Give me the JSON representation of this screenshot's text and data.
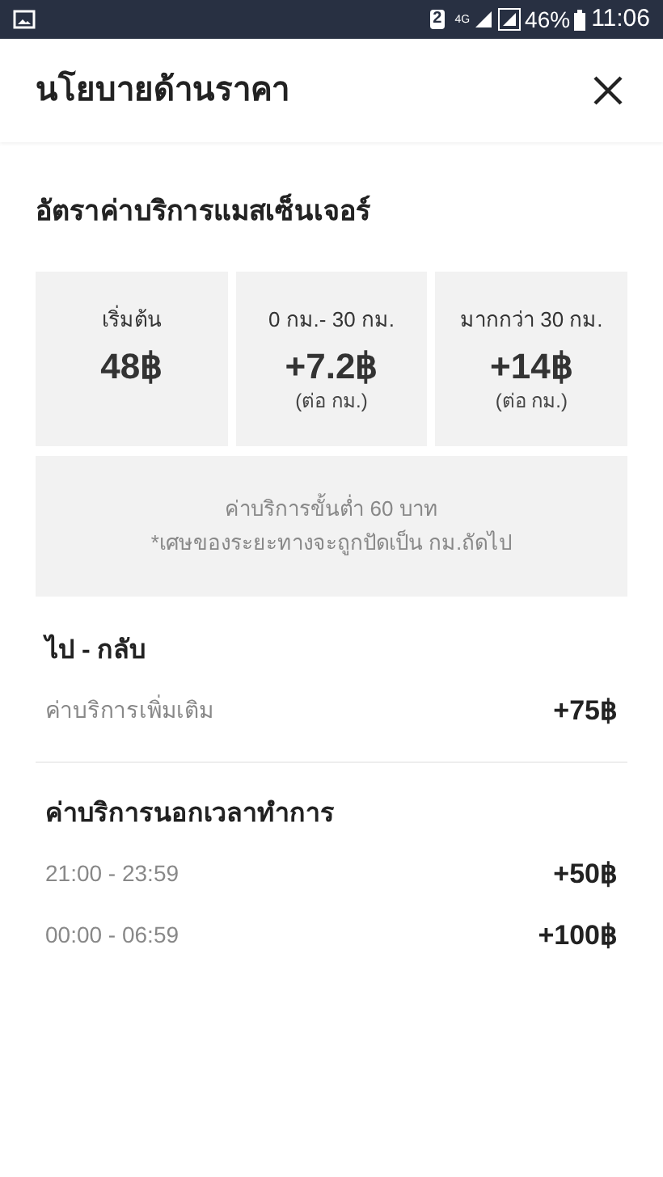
{
  "status_bar": {
    "sim": "2",
    "network": "4G",
    "battery": "46%",
    "time": "11:06"
  },
  "header": {
    "title": "นโยบายด้านราคา"
  },
  "section": {
    "title": "อัตราค่าบริการแมสเซ็นเจอร์"
  },
  "rate_cards": [
    {
      "label": "เริ่มต้น",
      "price": "48฿"
    },
    {
      "label": "0 กม.- 30 กม.",
      "price": "+7.2฿",
      "unit": "(ต่อ กม.)"
    },
    {
      "label": "มากกว่า 30 กม.",
      "price": "+14฿",
      "unit": "(ต่อ กม.)"
    }
  ],
  "note": [
    "ค่าบริการขั้นต่ำ 60 บาท",
    "*เศษของระยะทางจะถูกปัดเป็น กม.ถัดไป"
  ],
  "fee_groups": [
    {
      "title": "ไป - กลับ",
      "rows": [
        {
          "label": "ค่าบริการเพิ่มเติม",
          "price": "+75฿"
        }
      ]
    },
    {
      "title": "ค่าบริการนอกเวลาทำการ",
      "rows": [
        {
          "label": "21:00 - 23:59",
          "price": "+50฿"
        },
        {
          "label": "00:00 - 06:59",
          "price": "+100฿"
        }
      ]
    }
  ]
}
